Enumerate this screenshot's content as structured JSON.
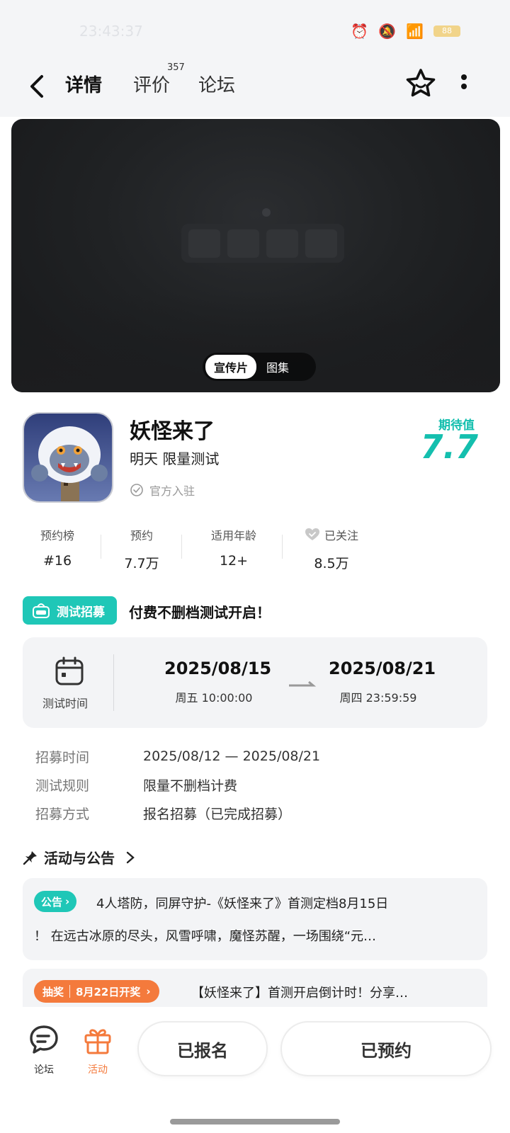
{
  "status_bar": {
    "time": "23:43:37",
    "battery": "88"
  },
  "nav": {
    "tabs": [
      {
        "label": "详情",
        "active": true
      },
      {
        "label": "评价",
        "count": "357"
      },
      {
        "label": "论坛"
      }
    ]
  },
  "banner": {
    "options": [
      "宣传片",
      "图集"
    ]
  },
  "game": {
    "title": "妖怪来了",
    "subtitle": "明天 限量测试",
    "official": "官方入驻",
    "expect_label": "期待值",
    "expect_value": "7.7"
  },
  "stats": [
    {
      "label": "预约榜",
      "value": "#16"
    },
    {
      "label": "预约",
      "value": "7.7万"
    },
    {
      "label": "适用年龄",
      "value": "12+"
    },
    {
      "label": "已关注",
      "value": "8.5万"
    }
  ],
  "recruit": {
    "badge": "测试招募",
    "title": "付费不删档测试开启！",
    "time_label": "测试时间",
    "start_date": "2025/08/15",
    "start_time": "周五  10:00:00",
    "end_date": "2025/08/21",
    "end_time": "周四  23:59:59",
    "rows": [
      {
        "key": "招募时间",
        "value": "2025/08/12 — 2025/08/21"
      },
      {
        "key": "测试规则",
        "value": "限量不删档计费"
      },
      {
        "key": "招募方式",
        "value": "报名招募（已完成招募）"
      }
    ]
  },
  "activity": {
    "header": "活动与公告",
    "notice_tag": "公告",
    "notice_line1": "4人塔防，同屏守护-《妖怪来了》首测定档8月15日",
    "notice_line2": "！ 在远古冰原的尽头，风雪呼啸，魔怪苏醒，一场围绕“元…",
    "lottery_tag": "抽奖",
    "lottery_date": "8月22日开奖",
    "lottery_text": "【妖怪来了】首测开启倒计时！分享…"
  },
  "bottom_bar": {
    "forum": "论坛",
    "activity": "活动",
    "signed": "已报名",
    "reserved": "已预约"
  },
  "colors": {
    "accent": "#1fc7b7",
    "orange": "#f47a3c"
  }
}
